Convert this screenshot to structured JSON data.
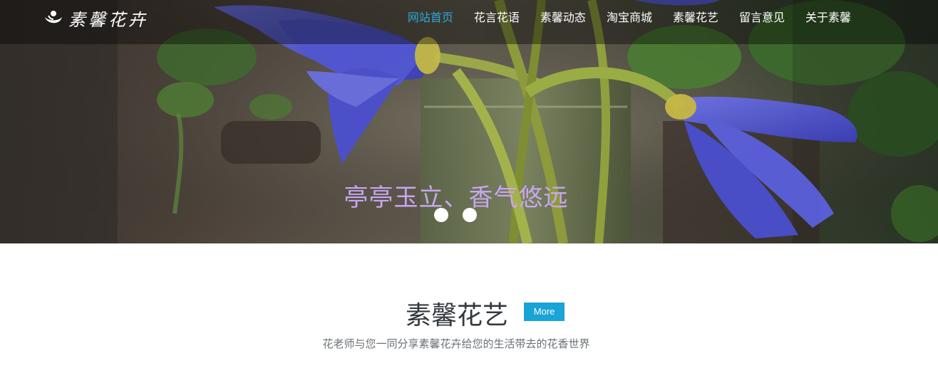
{
  "header": {
    "logo_text": "素馨花卉",
    "nav": [
      {
        "label": "网站首页",
        "active": true
      },
      {
        "label": "花言花语",
        "active": false
      },
      {
        "label": "素馨动态",
        "active": false
      },
      {
        "label": "淘宝商城",
        "active": false
      },
      {
        "label": "素馨花艺",
        "active": false
      },
      {
        "label": "留言意见",
        "active": false
      },
      {
        "label": "关于素馨",
        "active": false
      }
    ]
  },
  "hero": {
    "caption": "亭亭玉立、香气悠远",
    "slide_count": 2
  },
  "section": {
    "title": "素馨花艺",
    "more_label": "More",
    "subtitle": "花老师与您一同分享素馨花卉给您的生活带去的花香世界"
  },
  "colors": {
    "nav_active": "#2aa9d9",
    "caption": "#c7a6f0",
    "more_button": "#1aa3d6",
    "title": "#33393e",
    "subtitle": "#6b7176"
  },
  "icons": {
    "logo": "flower-logo-icon"
  }
}
